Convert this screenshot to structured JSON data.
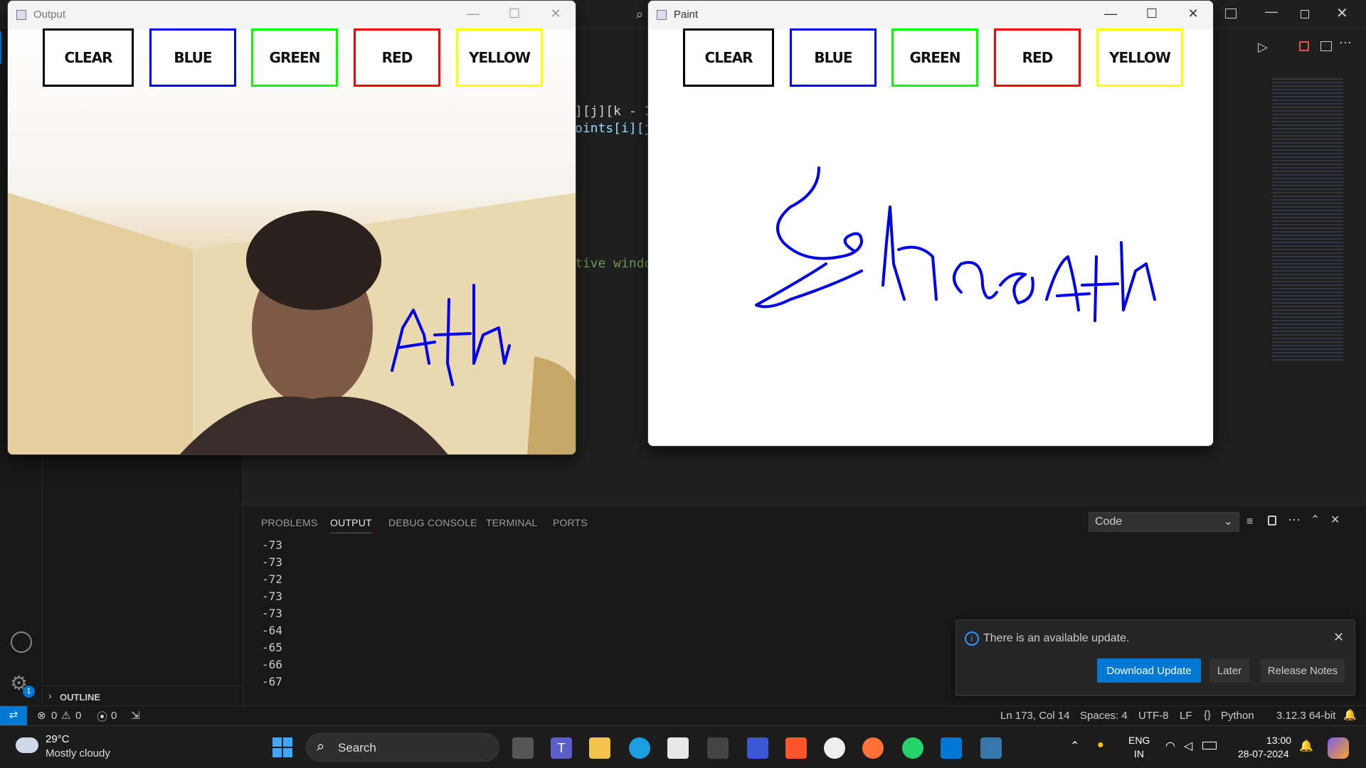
{
  "output_window": {
    "title": "Output",
    "buttons": [
      "CLEAR",
      "BLUE",
      "GREEN",
      "RED",
      "YELLOW"
    ],
    "drawn_text": "Ath"
  },
  "paint_window": {
    "title": "Paint",
    "buttons": [
      "CLEAR",
      "BLUE",
      "GREEN",
      "RED",
      "YELLOW"
    ],
    "drawn_text": "Shasrath"
  },
  "button_colors": {
    "CLEAR": "#000000",
    "BLUE": "#0000ff",
    "GREEN": "#00ff00",
    "RED": "#ff0000",
    "YELLOW": "#ffff00"
  },
  "editor": {
    "code_fragments": [
      "][j][k - 1",
      "oints[i][j]",
      "tive window"
    ]
  },
  "panel": {
    "tabs": [
      "PROBLEMS",
      "OUTPUT",
      "DEBUG CONSOLE",
      "TERMINAL",
      "PORTS"
    ],
    "active_tab": "OUTPUT",
    "channel": "Code",
    "output_lines": [
      "-73",
      "-73",
      "-72",
      "-73",
      "-73",
      "-64",
      "-65",
      "-66",
      "-67"
    ]
  },
  "sidebar": {
    "outline_label": "OUTLINE",
    "settings_badge": "1"
  },
  "notification": {
    "message": "There is an available update.",
    "primary": "Download Update",
    "later": "Later",
    "notes": "Release Notes"
  },
  "status": {
    "errors": "0",
    "warnings": "0",
    "ports": "0",
    "position": "Ln 173, Col 14",
    "spaces": "Spaces: 4",
    "encoding": "UTF-8",
    "eol": "LF",
    "language": "Python",
    "interpreter": "3.12.3 64-bit"
  },
  "taskbar": {
    "temp": "29°C",
    "weather": "Mostly cloudy",
    "search": "Search",
    "lang1": "ENG",
    "lang2": "IN",
    "time": "13:00",
    "date": "28-07-2024"
  }
}
